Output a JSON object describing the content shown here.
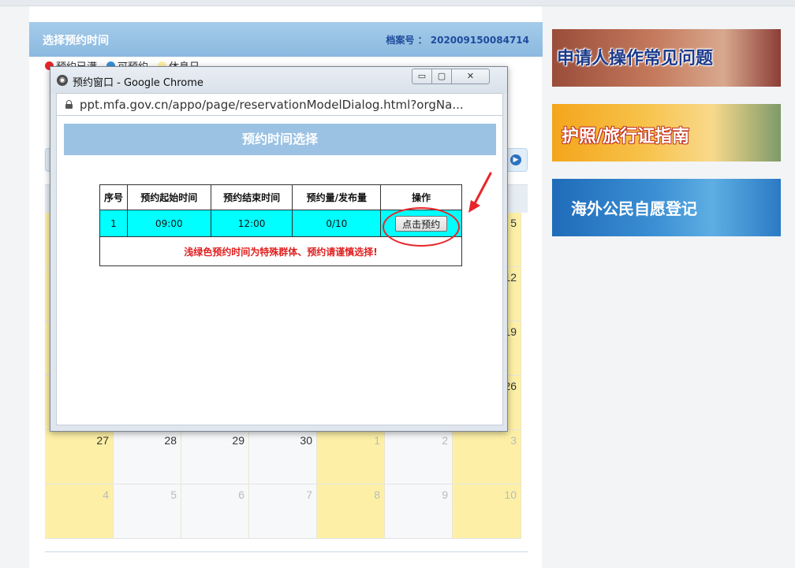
{
  "panel": {
    "title": "选择预约时间",
    "file_no": "档案号 ： 202009150084714"
  },
  "legend": [
    {
      "label": "预约已满",
      "color": "#e8262a"
    },
    {
      "label": "可预约",
      "color": "#3b8fd3"
    },
    {
      "label": "休息日",
      "color": "#fdf0a6"
    }
  ],
  "calendar": {
    "rows": [
      [
        {
          "d": "",
          "k": "weekend"
        },
        {
          "d": "",
          "k": "weekday"
        },
        {
          "d": "",
          "k": "weekday"
        },
        {
          "d": "",
          "k": "weekday"
        },
        {
          "d": "",
          "k": "weekday"
        },
        {
          "d": "",
          "k": "weekday"
        },
        {
          "d": "5",
          "k": "weekend"
        }
      ],
      [
        {
          "d": "",
          "k": "weekend"
        },
        {
          "d": "",
          "k": "weekday"
        },
        {
          "d": "",
          "k": "weekday"
        },
        {
          "d": "",
          "k": "weekday"
        },
        {
          "d": "",
          "k": "weekday"
        },
        {
          "d": "",
          "k": "weekday"
        },
        {
          "d": "12",
          "k": "weekend"
        }
      ],
      [
        {
          "d": "",
          "k": "weekend"
        },
        {
          "d": "",
          "k": "weekday"
        },
        {
          "d": "",
          "k": "weekday"
        },
        {
          "d": "",
          "k": "weekday"
        },
        {
          "d": "",
          "k": "weekday"
        },
        {
          "d": "",
          "k": "weekday"
        },
        {
          "d": "19",
          "k": "weekend"
        }
      ],
      [
        {
          "d": "",
          "k": "weekend"
        },
        {
          "d": "",
          "k": "weekday"
        },
        {
          "d": "",
          "k": "weekday"
        },
        {
          "d": "",
          "k": "weekday"
        },
        {
          "d": "",
          "k": "weekday"
        },
        {
          "d": "",
          "k": "weekday"
        },
        {
          "d": "26",
          "k": "weekend"
        }
      ],
      [
        {
          "d": "27",
          "k": "weekend"
        },
        {
          "d": "28",
          "k": "weekday"
        },
        {
          "d": "29",
          "k": "weekday"
        },
        {
          "d": "30",
          "k": "weekday"
        },
        {
          "d": "1",
          "k": "weekend other"
        },
        {
          "d": "2",
          "k": "weekday other"
        },
        {
          "d": "3",
          "k": "weekend other"
        }
      ],
      [
        {
          "d": "4",
          "k": "weekend other"
        },
        {
          "d": "5",
          "k": "weekday other"
        },
        {
          "d": "6",
          "k": "weekday other"
        },
        {
          "d": "7",
          "k": "weekday other"
        },
        {
          "d": "8",
          "k": "weekend other"
        },
        {
          "d": "9",
          "k": "weekday other"
        },
        {
          "d": "10",
          "k": "weekend other"
        }
      ]
    ]
  },
  "banners": [
    {
      "text": "申请人操作常见问题"
    },
    {
      "text": "护照/旅行证指南"
    },
    {
      "text": "海外公民自愿登记"
    }
  ],
  "popup": {
    "window_title": "预约窗口 - Google Chrome",
    "min_glyph": "▭",
    "max_glyph": "▢",
    "close_glyph": "✕",
    "url": "ppt.mfa.gov.cn/appo/page/reservationModelDialog.html?orgNa...",
    "header": "预约时间选择",
    "table": {
      "headers": [
        "序号",
        "预约起始时间",
        "预约结束时间",
        "预约量/发布量",
        "操作"
      ],
      "row": {
        "no": "1",
        "start": "09:00",
        "end": "12:00",
        "count": "0/10",
        "action": "点击预约"
      },
      "note": "浅绿色预约时间为特殊群体、预约请谨慎选择!"
    }
  },
  "colors": {
    "annotation_red": "#e8262a",
    "slot_cyan": "#00ffff",
    "header_blue": "#9bc2e3"
  }
}
